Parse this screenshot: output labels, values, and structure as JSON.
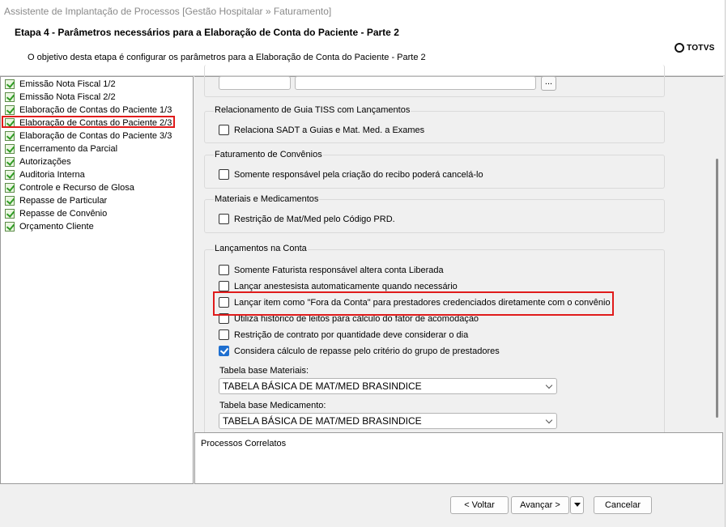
{
  "window": {
    "title": "Assistente de Implantação de Processos [Gestão Hospitalar » Faturamento]"
  },
  "header": {
    "step_title": "Etapa 4 - Parâmetros necessários para a Elaboração de Conta do Paciente - Parte 2",
    "step_description": "O objetivo desta etapa é configurar os parâmetros para a Elaboração de Conta do Paciente - Parte 2",
    "logo_text": "TOTVS"
  },
  "tree": {
    "items": [
      {
        "label": "Emissão Nota Fiscal 1/2",
        "icon": "checklist-icon"
      },
      {
        "label": "Emissão Nota Fiscal 2/2",
        "icon": "checklist-icon"
      },
      {
        "label": "Elaboração de Contas do Paciente 1/3",
        "icon": "checklist-icon"
      },
      {
        "label": "Elaboração de Contas do Paciente 2/3",
        "icon": "checklist-icon",
        "selected": true
      },
      {
        "label": "Elaboração de Contas do Paciente 3/3",
        "icon": "checklist-icon"
      },
      {
        "label": "Encerramento da Parcial",
        "icon": "checklist-icon"
      },
      {
        "label": "Autorizações",
        "icon": "checklist-icon"
      },
      {
        "label": "Auditoria Interna",
        "icon": "checklist-icon"
      },
      {
        "label": "Controle e Recurso de Glosa",
        "icon": "checklist-icon"
      },
      {
        "label": "Repasse de Particular",
        "icon": "checklist-icon"
      },
      {
        "label": "Repasse de Convênio",
        "icon": "checklist-icon"
      },
      {
        "label": "Orçamento Cliente",
        "icon": "checklist-icon"
      }
    ]
  },
  "content": {
    "top_fields": {
      "code_value": "",
      "description_value": "",
      "browse_label": "..."
    },
    "groups": [
      {
        "title": "Relacionamento de Guia TISS com Lançamentos",
        "options": [
          {
            "label": "Relaciona SADT a Guias e Mat. Med. a Exames",
            "checked": false
          }
        ]
      },
      {
        "title": "Faturamento de Convênios",
        "options": [
          {
            "label": "Somente responsável pela criação do recibo poderá cancelá-lo",
            "checked": false
          }
        ]
      },
      {
        "title": "Materiais e Medicamentos",
        "options": [
          {
            "label": "Restrição de Mat/Med pelo Código PRD.",
            "checked": false
          }
        ]
      },
      {
        "title": "Lançamentos na Conta",
        "options": [
          {
            "label": "Somente Faturista responsável altera conta Liberada",
            "checked": false
          },
          {
            "label": "Lançar anestesista automaticamente quando necessário",
            "checked": false
          },
          {
            "label": "Lançar item como \"Fora da Conta\" para prestadores credenciados diretamente com o convênio",
            "checked": false
          },
          {
            "label": "Utiliza histórico de leitos para cálculo do fator de acomodação",
            "checked": false
          },
          {
            "label": "Restrição de contrato por quantidade deve considerar o dia",
            "checked": false
          },
          {
            "label": "Considera cálculo de repasse pelo critério do grupo de prestadores",
            "checked": true
          }
        ],
        "selects": [
          {
            "label": "Tabela base Materiais:",
            "value": "TABELA BÁSICA DE MAT/MED BRASINDICE"
          },
          {
            "label": "Tabela base Medicamento:",
            "value": "TABELA BÁSICA DE MAT/MED BRASINDICE"
          }
        ]
      }
    ]
  },
  "related": {
    "label": "Processos Correlatos"
  },
  "footer": {
    "back_label": "< Voltar",
    "next_label": "Avançar >",
    "cancel_label": "Cancelar"
  },
  "colors": {
    "highlight": "#e01b1b",
    "checkbox_checked": "#1e6fd0",
    "tree_check": "#2f9b24"
  }
}
